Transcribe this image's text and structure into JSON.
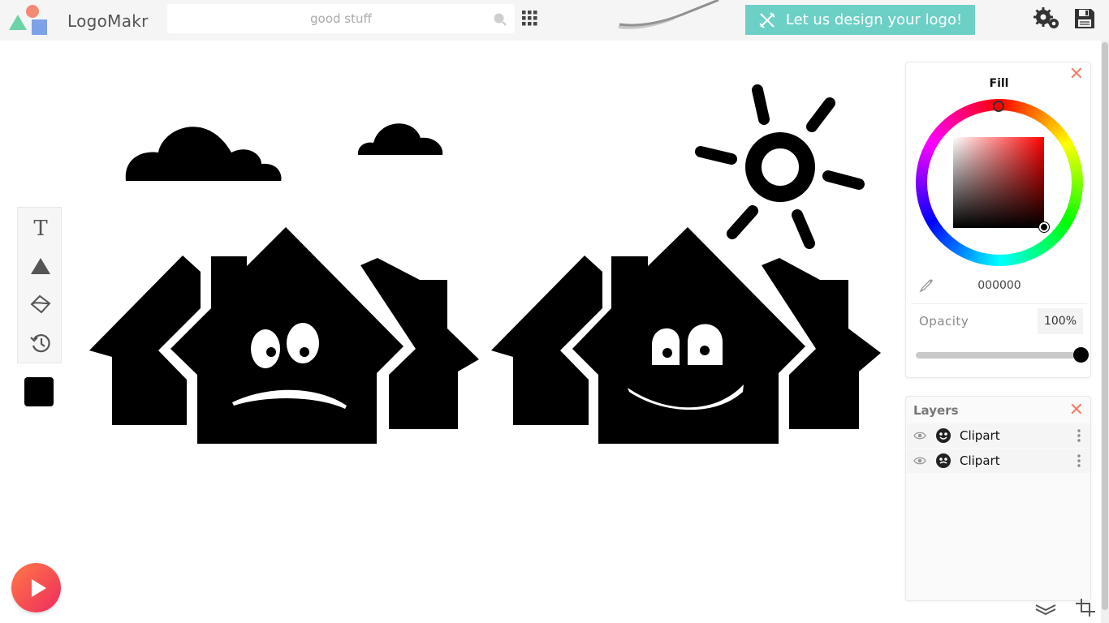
{
  "app": {
    "name": "LogoMakr"
  },
  "search": {
    "value": "",
    "placeholder": "good stuff"
  },
  "header": {
    "cta_label": "Let us design your logo!"
  },
  "toolbar": {
    "tools": [
      {
        "name": "text-tool",
        "icon": "text-icon"
      },
      {
        "name": "shapes-tool",
        "icon": "triangle-icon"
      },
      {
        "name": "fill-tool",
        "icon": "paint-bucket-icon"
      },
      {
        "name": "history-tool",
        "icon": "history-icon"
      }
    ],
    "current_color": "#000000"
  },
  "fill_panel": {
    "title": "Fill",
    "hex": "000000",
    "opacity_label": "Opacity",
    "opacity_value": "100%",
    "opacity_fraction": 1.0
  },
  "layers_panel": {
    "title": "Layers",
    "items": [
      {
        "label": "Clipart"
      },
      {
        "label": "Clipart"
      }
    ]
  },
  "colors": {
    "accent": "#6cd0c6",
    "close": "#f0806a"
  }
}
